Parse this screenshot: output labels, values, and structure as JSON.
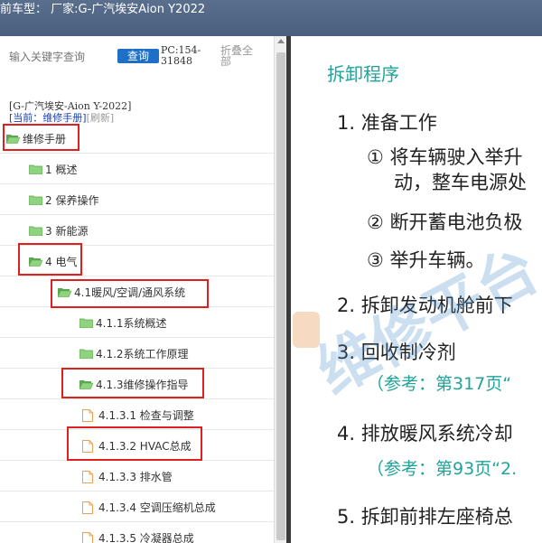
{
  "window": {
    "title": "前车型： 厂家:G-广汽埃安Aion Y2022"
  },
  "search": {
    "placeholder": "输入关键字查询",
    "button_label": "查询"
  },
  "pc_info": "PC:154-31848",
  "collapse_all": "折叠全部",
  "car_info": "[G-广汽埃安-Aion Y-2022]",
  "current": {
    "label": "[当前：维修手册]",
    "refresh": "[刷新]"
  },
  "tree": [
    {
      "label": "维修手册",
      "type": "folder",
      "highlight": true
    },
    {
      "label": "1 概述",
      "type": "folder",
      "highlight": false
    },
    {
      "label": "2 保养操作",
      "type": "folder",
      "highlight": false
    },
    {
      "label": "3 新能源",
      "type": "folder",
      "highlight": false
    },
    {
      "label": "4 电气",
      "type": "folder",
      "highlight": true
    },
    {
      "label": "4.1暖风/空调/通风系统",
      "type": "folder",
      "highlight": true
    },
    {
      "label": "4.1.1系统概述",
      "type": "folder",
      "highlight": false
    },
    {
      "label": "4.1.2系统工作原理",
      "type": "folder",
      "highlight": false
    },
    {
      "label": "4.1.3维修操作指导",
      "type": "folder",
      "highlight": true
    },
    {
      "label": "4.1.3.1 检查与调整",
      "type": "doc",
      "highlight": false
    },
    {
      "label": "4.1.3.2 HVAC总成",
      "type": "doc",
      "highlight": true
    },
    {
      "label": "4.1.3.3 排水管",
      "type": "doc",
      "highlight": false
    },
    {
      "label": "4.1.3.4 空调压缩机总成",
      "type": "doc",
      "highlight": false
    },
    {
      "label": "4.1.3.5 冷凝器总成",
      "type": "doc",
      "highlight": false
    }
  ],
  "document": {
    "title": "拆卸程序",
    "steps": [
      "1.  准备工作",
      "① 将车辆驶入举升",
      "动，整车电源处",
      "② 断开蓄电池负极",
      "③ 举升车辆。",
      "2.  拆卸发动机舱前下",
      "3.  回收制冷剂",
      "4.  排放暖风系统冷却",
      "5.  拆卸前排左座椅总"
    ],
    "refs": [
      "（参考：第317页“",
      "（参考：第93页“2."
    ],
    "watermark": "维修平台"
  },
  "colors": {
    "accent": "#1f6fc6",
    "highlight_box": "#e02020",
    "doc_teal": "#1fa39a",
    "folder_green": "#7cc576",
    "doc_orange": "#f0a050"
  }
}
